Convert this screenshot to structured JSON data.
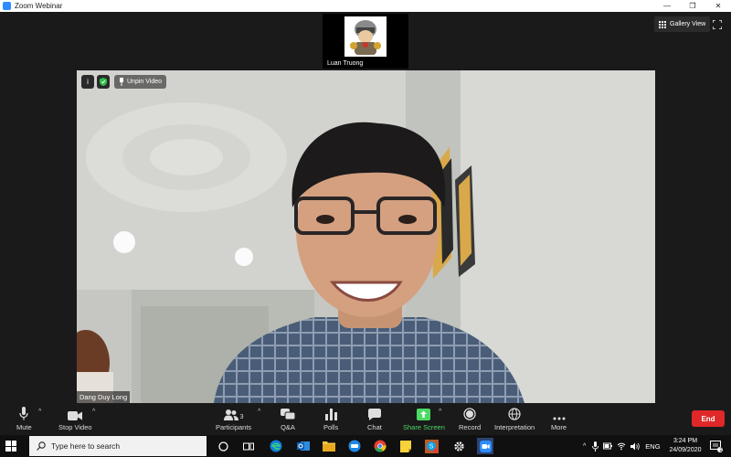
{
  "window": {
    "title": "Zoom Webinar",
    "controls": [
      "—",
      "❐",
      "✕"
    ]
  },
  "view": {
    "gallery_label": "Gallery View"
  },
  "thumbnail": {
    "participant_name": "Luan Truong"
  },
  "main_video": {
    "info_symbol": "i",
    "unpin_label": "Unpin Video",
    "participant_name": "Dang Duy Long"
  },
  "toolbar": {
    "mute_label": "Mute",
    "stop_video_label": "Stop Video",
    "participants_label": "Participants",
    "participants_count": "3",
    "qa_label": "Q&A",
    "polls_label": "Polls",
    "chat_label": "Chat",
    "share_screen_label": "Share Screen",
    "record_label": "Record",
    "interpretation_label": "Interpretation",
    "more_label": "More",
    "end_label": "End",
    "caret": "^"
  },
  "taskbar": {
    "search_placeholder": "Type here to search",
    "language": "ENG",
    "time": "3:24 PM",
    "date": "24/09/2020",
    "notification_count": "2",
    "apps": [
      "task-view",
      "edge",
      "outlook",
      "file-explorer",
      "zalo",
      "chrome",
      "sticky-notes",
      "skype",
      "settings",
      "zoom"
    ]
  },
  "colors": {
    "zoom_blue": "#2d8cff",
    "share_green": "#4cd964",
    "end_red": "#e02828",
    "background": "#1a1a1a"
  }
}
